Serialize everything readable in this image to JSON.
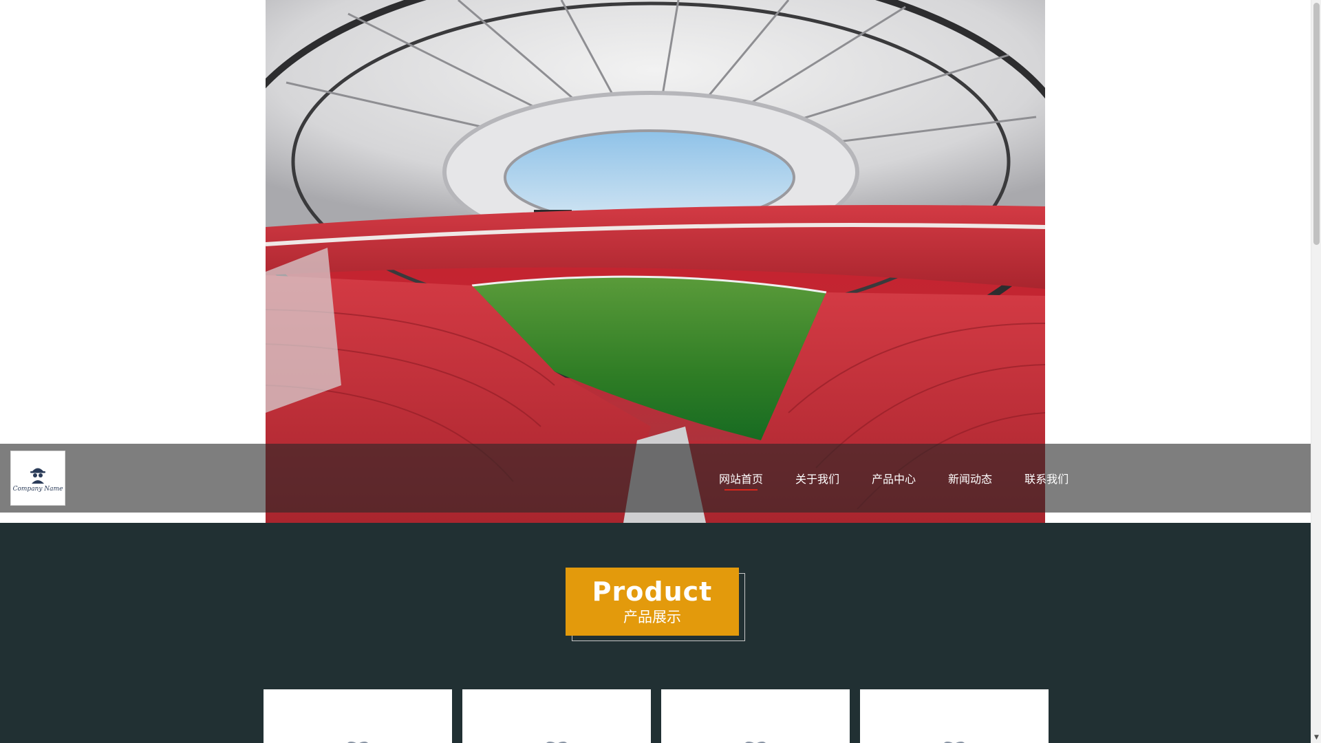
{
  "header": {
    "logo": {
      "text": "Company Name",
      "icon": "spy-icon"
    },
    "nav": [
      {
        "label": "网站首页",
        "active": true
      },
      {
        "label": "关于我们",
        "active": false
      },
      {
        "label": "产品中心",
        "active": false
      },
      {
        "label": "新闻动态",
        "active": false
      },
      {
        "label": "联系我们",
        "active": false
      }
    ]
  },
  "hero": {
    "image": "stadium-banner"
  },
  "products": {
    "title_en": "Product",
    "title_cn": "产品展示",
    "cards": [
      {
        "icon": "product-icon"
      },
      {
        "icon": "product-icon"
      },
      {
        "icon": "product-icon"
      },
      {
        "icon": "product-icon"
      }
    ]
  },
  "colors": {
    "accent": "#e39a0c",
    "nav_active": "#d8261c",
    "section_bg": "#213033"
  }
}
